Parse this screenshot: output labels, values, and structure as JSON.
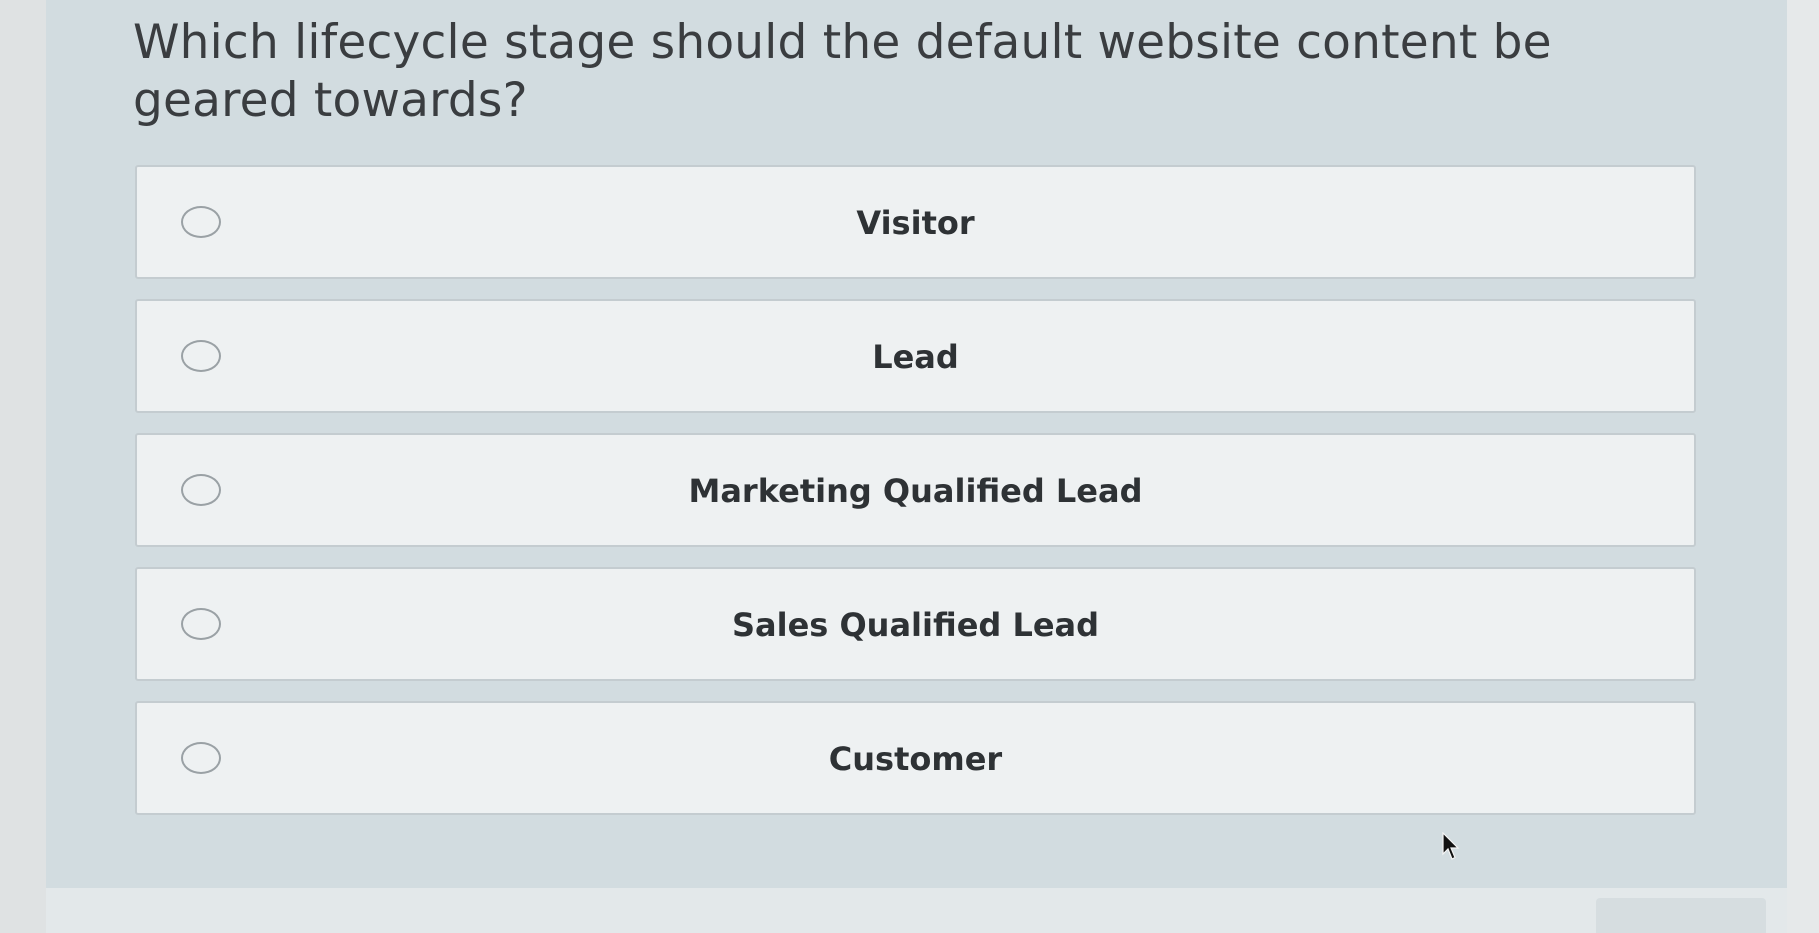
{
  "question": {
    "text": "Which lifecycle stage should the default website content be geared towards?"
  },
  "options": [
    {
      "label": "Visitor"
    },
    {
      "label": "Lead"
    },
    {
      "label": "Marketing Qualified Lead"
    },
    {
      "label": "Sales Qualified Lead"
    },
    {
      "label": "Customer"
    }
  ],
  "colors": {
    "panel_background": "#d2dce0",
    "option_background": "#eef1f2",
    "option_border": "#c4ccd0",
    "text": "#2e3235"
  },
  "icons": {
    "radio": "radio-unchecked-icon",
    "cursor": "mouse-pointer-icon"
  }
}
